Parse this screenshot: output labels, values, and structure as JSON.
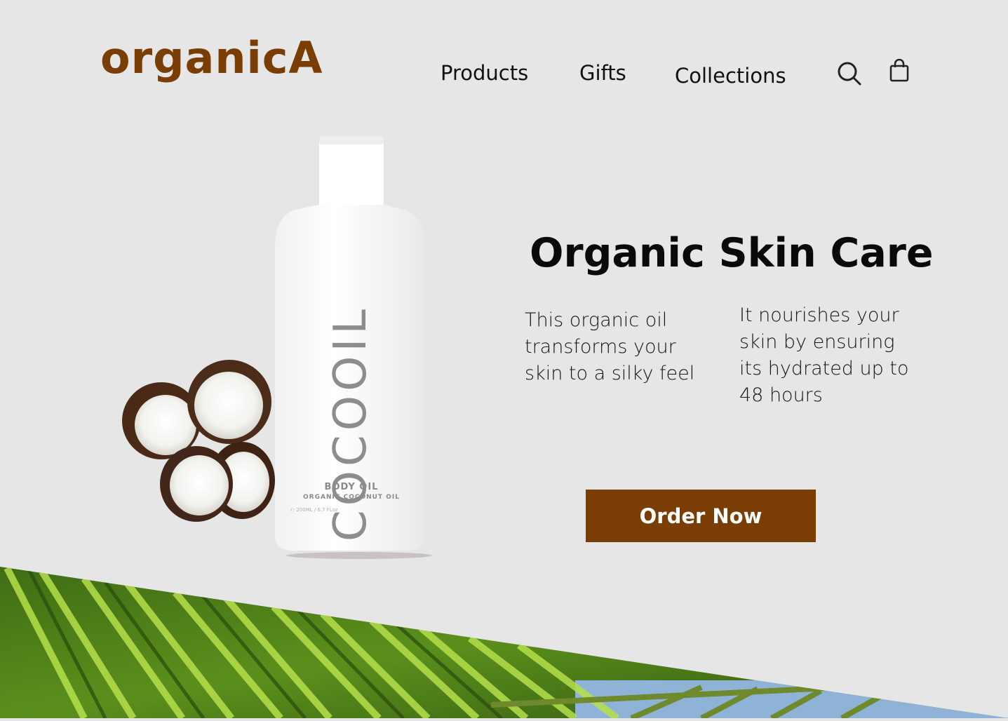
{
  "brand": {
    "logo_text": "organicA",
    "color": "#7a3e05"
  },
  "nav": {
    "items": [
      {
        "label": "Products"
      },
      {
        "label": "Gifts"
      },
      {
        "label": "Collections"
      }
    ],
    "icons": [
      "search-icon",
      "shopping-bag-icon"
    ]
  },
  "hero": {
    "title": "Organic Skin Care",
    "paragraph_left": "This organic oil transforms your skin to a silky feel",
    "paragraph_right": "It nourishes your skin by ensuring its hydrated up to 48 hours",
    "cta_label": "Order Now"
  },
  "product": {
    "brand_text": "COCOOIL",
    "type_text": "BODY OIL",
    "subtitle_text": "ORGANIC COCONUT OIL",
    "volume_text": "℮ 200ML / 6.7 FLoz"
  },
  "colors": {
    "background": "#e6e6e6",
    "accent": "#7a3e05",
    "text": "#111111"
  }
}
